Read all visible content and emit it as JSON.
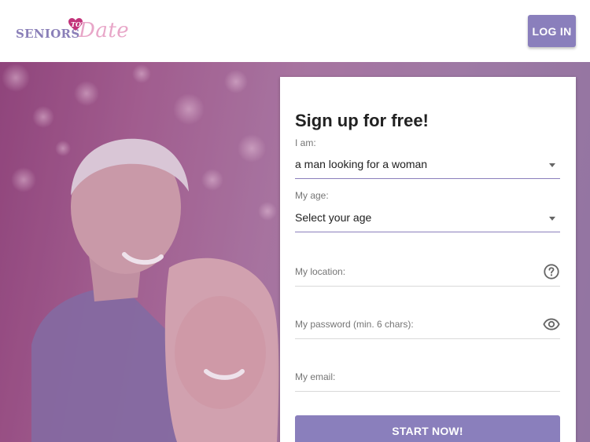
{
  "header": {
    "logo": {
      "part1": "SENIORS",
      "part2": "TO",
      "part3": "Date"
    },
    "login_label": "LOG IN"
  },
  "hero": {
    "photo_subject": "smiling senior couple embracing"
  },
  "signup": {
    "title": "Sign up for free!",
    "iam_label": "I am:",
    "iam_value": "a man looking for a woman",
    "age_label": "My age:",
    "age_value": "Select your age",
    "location_placeholder": "My location:",
    "password_placeholder": "My password (min. 6 chars):",
    "email_placeholder": "My email:",
    "submit_label": "START NOW!"
  },
  "icons": {
    "location_help": "help-circle-icon",
    "password_toggle": "eye-icon",
    "dropdown": "caret-down-icon"
  },
  "colors": {
    "accent": "#8a7fbc",
    "logo_seniors": "#8a7fb8",
    "logo_date": "#e8a6c8",
    "heart": "#c2337a",
    "overlay": "#a15c8e"
  }
}
